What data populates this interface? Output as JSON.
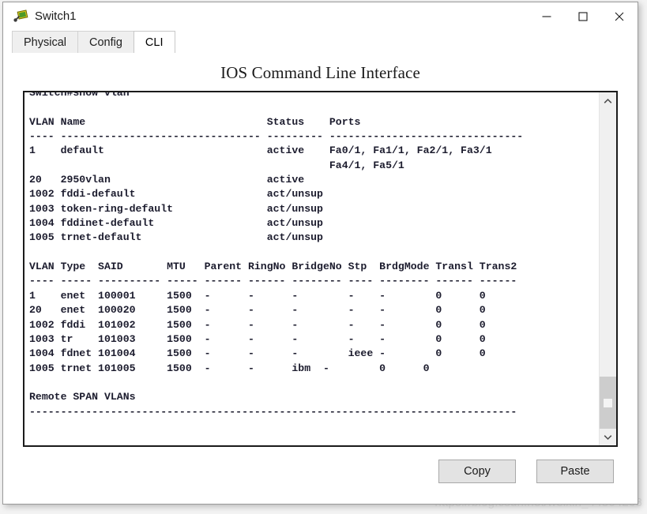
{
  "window": {
    "title": "Switch1",
    "icon": "switch-device-icon",
    "controls": {
      "minimize": "minimize-icon",
      "maximize": "maximize-icon",
      "close": "close-icon"
    }
  },
  "tabs": [
    {
      "label": "Physical",
      "active": false
    },
    {
      "label": "Config",
      "active": false
    },
    {
      "label": "CLI",
      "active": true
    }
  ],
  "panel": {
    "heading": "IOS Command Line Interface"
  },
  "terminal": {
    "prompt_line": "Switch#show vlan",
    "content": "Switch#show vlan\n\nVLAN Name                             Status    Ports\n---- -------------------------------- --------- -------------------------------\n1    default                          active    Fa0/1, Fa1/1, Fa2/1, Fa3/1\n                                                Fa4/1, Fa5/1\n20   2950vlan                         active    \n1002 fddi-default                     act/unsup \n1003 token-ring-default               act/unsup \n1004 fddinet-default                  act/unsup \n1005 trnet-default                    act/unsup \n\nVLAN Type  SAID       MTU   Parent RingNo BridgeNo Stp  BrdgMode Transl Trans2\n---- ----- ---------- ----- ------ ------ -------- ---- -------- ------ ------\n1    enet  100001     1500  -      -      -        -    -        0      0\n20   enet  100020     1500  -      -      -        -    -        0      0\n1002 fddi  101002     1500  -      -      -        -    -        0      0\n1003 tr    101003     1500  -      -      -        -    -        0      0\n1004 fdnet 101004     1500  -      -      -        ieee -        0      0\n1005 trnet 101005     1500  -      -      ibm  -        0      0\n\nRemote SPAN VLANs\n------------------------------------------------------------------------------\n",
    "lines": [
      "Switch#show vlan",
      "",
      "VLAN Name                             Status    Ports",
      "---- -------------------------------- --------- -------------------------------",
      "1    default                          active    Fa0/1, Fa1/1, Fa2/1, Fa3/1",
      "                                                Fa4/1, Fa5/1",
      "20   2950vlan                         active",
      "1002 fddi-default                     act/unsup",
      "1003 token-ring-default               act/unsup",
      "1004 fddinet-default                  act/unsup",
      "1005 trnet-default                    act/unsup",
      "",
      "VLAN Type  SAID       MTU   Parent RingNo BridgeNo Stp  BrdgMode Transl Trans2",
      "---- ----- ---------- ----- ------ ------ -------- ---- -------- ------ ------",
      "1    enet  100001     1500  -      -      -        -    -        0      0",
      "20   enet  100020     1500  -      -      -        -    -        0      0",
      "1002 fddi  101002     1500  -      -      -        -    -        0      0",
      "1003 tr    101003     1500  -      -      -        -    -        0      0",
      "1004 fdnet 101004     1500  -      -      -        ieee -        0      0",
      "1005 trnet 101005     1500  -      -      -        ibm  -        0      0",
      "",
      "Remote SPAN VLANs",
      "------------------------------------------------------------------------------"
    ],
    "vlan_table": {
      "headers": [
        "VLAN",
        "Name",
        "Status",
        "Ports"
      ],
      "rows": [
        {
          "vlan": "1",
          "name": "default",
          "status": "active",
          "ports": [
            "Fa0/1, Fa1/1, Fa2/1, Fa3/1",
            "Fa4/1, Fa5/1"
          ]
        },
        {
          "vlan": "20",
          "name": "2950vlan",
          "status": "active",
          "ports": []
        },
        {
          "vlan": "1002",
          "name": "fddi-default",
          "status": "act/unsup",
          "ports": []
        },
        {
          "vlan": "1003",
          "name": "token-ring-default",
          "status": "act/unsup",
          "ports": []
        },
        {
          "vlan": "1004",
          "name": "fddinet-default",
          "status": "act/unsup",
          "ports": []
        },
        {
          "vlan": "1005",
          "name": "trnet-default",
          "status": "act/unsup",
          "ports": []
        }
      ]
    },
    "vlan_detail_table": {
      "headers": [
        "VLAN",
        "Type",
        "SAID",
        "MTU",
        "Parent",
        "RingNo",
        "BridgeNo",
        "Stp",
        "BrdgMode",
        "Transl",
        "Trans2"
      ],
      "rows": [
        [
          "1",
          "enet",
          "100001",
          "1500",
          "-",
          "-",
          "-",
          "-",
          "-",
          "0",
          "0"
        ],
        [
          "20",
          "enet",
          "100020",
          "1500",
          "-",
          "-",
          "-",
          "-",
          "-",
          "0",
          "0"
        ],
        [
          "1002",
          "fddi",
          "101002",
          "1500",
          "-",
          "-",
          "-",
          "-",
          "-",
          "0",
          "0"
        ],
        [
          "1003",
          "tr",
          "101003",
          "1500",
          "-",
          "-",
          "-",
          "-",
          "-",
          "0",
          "0"
        ],
        [
          "1004",
          "fdnet",
          "101004",
          "1500",
          "-",
          "-",
          "-",
          "ieee",
          "-",
          "0",
          "0"
        ],
        [
          "1005",
          "trnet",
          "101005",
          "1500",
          "-",
          "-",
          "-",
          "ibm",
          "-",
          "0",
          "0"
        ]
      ]
    },
    "remote_span_heading": "Remote SPAN VLANs"
  },
  "scrollbar": {
    "up_arrow": "chevron-up-icon",
    "down_arrow": "chevron-down-icon",
    "thumb_position_percent": 84
  },
  "footer": {
    "copy_label": "Copy",
    "paste_label": "Paste"
  },
  "watermark": {
    "text": "https://blog.csdn.net/weixin_44864268"
  },
  "colors": {
    "terminal_text": "#1c1c2e",
    "window_border": "#9a9a9a",
    "terminal_border": "#1b1b1b",
    "button_face": "#e3e3e3",
    "active_tab": "#ffffff",
    "inactive_tab": "#efefef",
    "scrollbar_thumb": "#cdcdcd",
    "watermark": "#e2e2e2"
  }
}
